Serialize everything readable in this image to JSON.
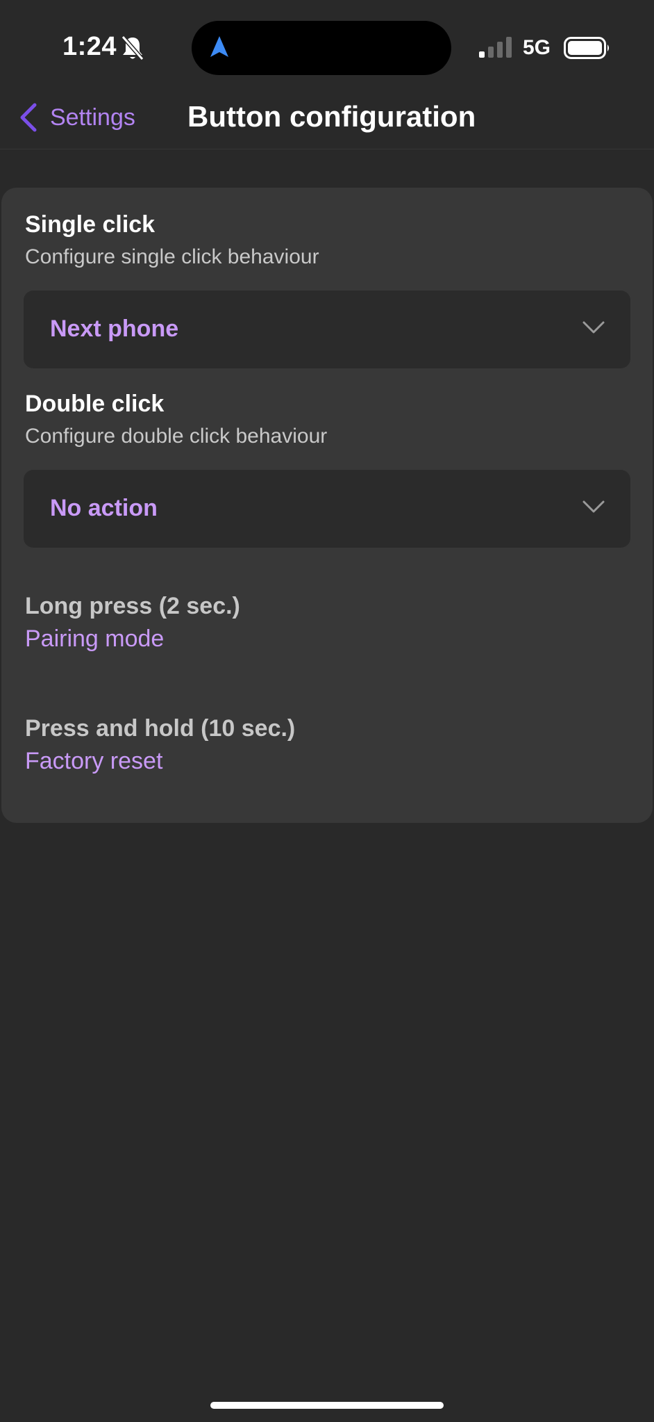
{
  "status_bar": {
    "time": "1:24",
    "network": "5G",
    "icons": [
      "bell-off-icon",
      "navigation-arrow-icon",
      "signal-icon",
      "battery-icon"
    ]
  },
  "nav": {
    "back_label": "Settings",
    "title": "Button configuration"
  },
  "single_click": {
    "title": "Single click",
    "description": "Configure single click behaviour",
    "selected": "Next phone"
  },
  "double_click": {
    "title": "Double click",
    "description": "Configure double click behaviour",
    "selected": "No action"
  },
  "long_press": {
    "title": "Long press (2 sec.)",
    "value": "Pairing mode"
  },
  "press_hold": {
    "title": "Press and hold (10 sec.)",
    "value": "Factory reset"
  },
  "colors": {
    "background": "#292929",
    "card": "#383838",
    "accent": "#c99af7",
    "back_accent": "#7b4fe8"
  }
}
